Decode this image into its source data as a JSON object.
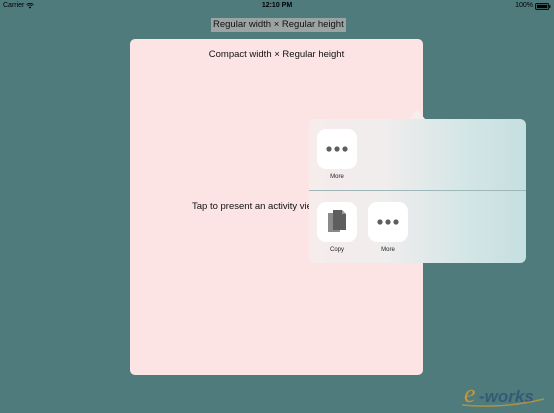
{
  "status_bar": {
    "carrier": "Carrier",
    "time": "12:10 PM",
    "battery": "100%"
  },
  "main": {
    "size_class_label": "Regular width × Regular height"
  },
  "presented_sheet": {
    "title": "Compact width × Regular height",
    "body": "Tap to present an activity vie"
  },
  "activity_popover": {
    "top_row": [
      {
        "label": "More",
        "icon": "more-icon"
      }
    ],
    "bottom_row": [
      {
        "label": "Copy",
        "icon": "copy-icon"
      },
      {
        "label": "More",
        "icon": "more-icon"
      }
    ]
  },
  "colors": {
    "background": "#4f7b7d",
    "sheet": "#fde4e4",
    "tile": "#ffffff",
    "icon": "#5e5e5e"
  },
  "watermark": {
    "brand": "e-works"
  }
}
